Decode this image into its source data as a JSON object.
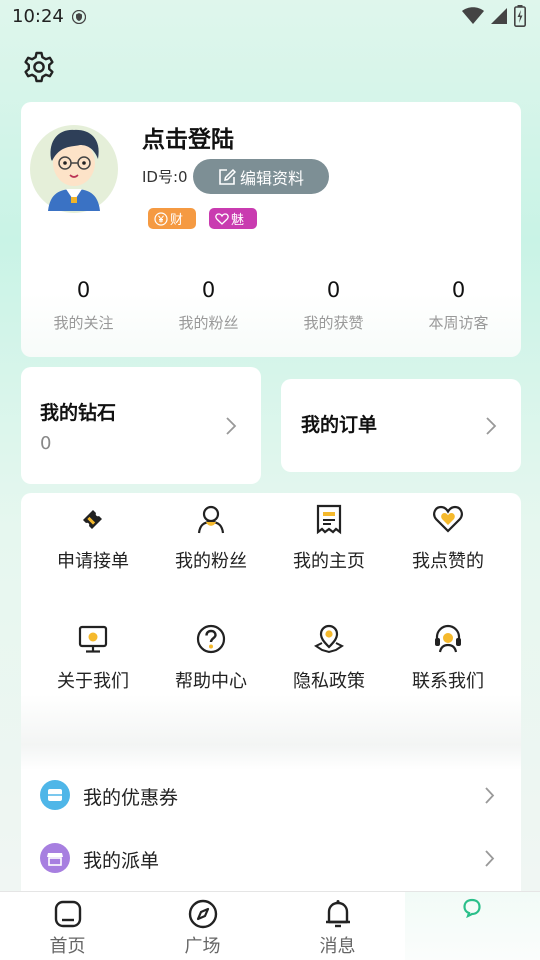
{
  "status": {
    "time": "10:24"
  },
  "profile": {
    "name": "点击登陆",
    "id_label": "ID号:0",
    "edit_label": "编辑资料",
    "badges": {
      "wealth": "财",
      "charm": "魅"
    },
    "stats": [
      {
        "value": "0",
        "label": "我的关注"
      },
      {
        "value": "0",
        "label": "我的粉丝"
      },
      {
        "value": "0",
        "label": "我的获赞"
      },
      {
        "value": "0",
        "label": "本周访客"
      }
    ]
  },
  "diamond": {
    "title": "我的钻石",
    "value": "0"
  },
  "orders": {
    "title": "我的订单"
  },
  "grid": [
    {
      "label": "申请接单",
      "icon": "ticket-icon"
    },
    {
      "label": "我的粉丝",
      "icon": "person-icon"
    },
    {
      "label": "我的主页",
      "icon": "receipt-icon"
    },
    {
      "label": "我点赞的",
      "icon": "heart-icon"
    },
    {
      "label": "关于我们",
      "icon": "monitor-icon"
    },
    {
      "label": "帮助中心",
      "icon": "help-icon"
    },
    {
      "label": "隐私政策",
      "icon": "location-icon"
    },
    {
      "label": "联系我们",
      "icon": "headset-icon"
    }
  ],
  "list": [
    {
      "label": "我的优惠券",
      "icon": "coupon-icon",
      "color": "#4fb6e8"
    },
    {
      "label": "我的派单",
      "icon": "store-icon",
      "color": "#a77fe0"
    }
  ],
  "tabs": [
    {
      "label": "首页",
      "icon": "home-icon"
    },
    {
      "label": "广场",
      "icon": "compass-icon"
    },
    {
      "label": "消息",
      "icon": "bell-icon"
    },
    {
      "label": "",
      "icon": "chat-bubble-icon"
    }
  ],
  "colors": {
    "accent": "#f5b92c",
    "edit_button": "#7d8f95",
    "wealth_badge": "#f59a42",
    "charm_badge": "#c93bb0",
    "active_tab": "#2bbf8a"
  }
}
